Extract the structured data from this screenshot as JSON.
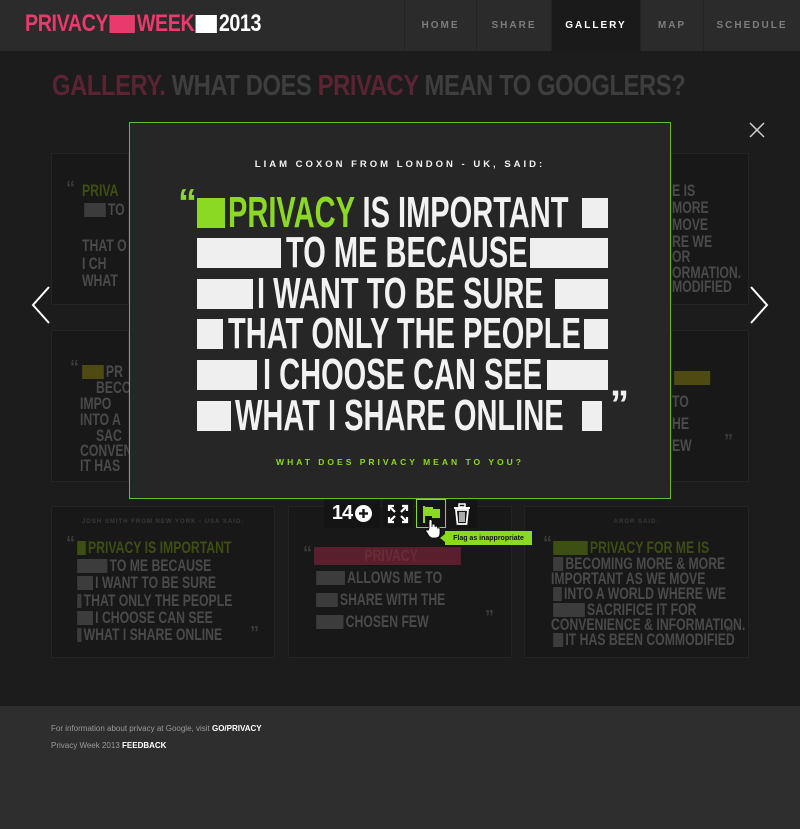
{
  "header": {
    "logo": {
      "part1": "PRIVACY",
      "part2": "WEEK",
      "year": "2013"
    },
    "nav": [
      {
        "label": "HOME",
        "active": false
      },
      {
        "label": "SHARE",
        "active": false
      },
      {
        "label": "GALLERY",
        "active": true
      },
      {
        "label": "MAP",
        "active": false
      },
      {
        "label": "SCHEDULE",
        "active": false
      }
    ]
  },
  "page": {
    "heading_prefix": "GALLERY.",
    "heading_mid": "WHAT DOES",
    "heading_highlight": "PRIVACY",
    "heading_suffix": "MEAN TO GOOGLERS?"
  },
  "background_cards": {
    "card_bl_caption": "JOSH SMITH FROM NEW YORK - USA SAID:",
    "card_bl_lines": [
      "PRIVACY IS IMPORTANT",
      "TO ME BECAUSE",
      "I WANT TO BE SURE",
      "THAT ONLY THE PEOPLE",
      "I CHOOSE CAN SEE",
      "WHAT I SHARE ONLINE"
    ],
    "card_bm_lines": [
      "PRIVACY",
      "ALLOWS ME TO",
      "SHARE WITH THE",
      "CHOSEN FEW"
    ],
    "card_br_caption": "AROR SAID:",
    "card_br_lines": [
      "PRIVACY FOR ME IS",
      "BECOMING MORE & MORE",
      "IMPORTANT AS WE MOVE",
      "INTO A WORLD WHERE WE",
      "SACRIFICE IT FOR",
      "CONVENIENCE & INFORMATION.",
      "IT HAS BEEN COMMODIFIED"
    ],
    "card_tl_lines": [
      "PRIVA",
      "TO",
      "THAT O",
      "I CH",
      "WHAT"
    ],
    "card_ml_lines": [
      "PR",
      "BECOM",
      "IMPO",
      "INTO A",
      "SAC",
      "CONVENIE",
      "IT HAS"
    ],
    "card_tr_lines": [
      "E IS",
      "MORE",
      "MOVE",
      "RE WE",
      "OR",
      "ORMATION.",
      "MODIFIED"
    ],
    "card_mr_lines": [
      "TO",
      "HE",
      "EW"
    ]
  },
  "modal": {
    "caption": "LIAM COXON FROM LONDON - UK, SAID:",
    "quote_open": "“",
    "quote_close": "”",
    "line1_highlight": "PRIVACY",
    "line1_rest": "IS IMPORTANT",
    "line2": "TO ME BECAUSE",
    "line3": "I WANT TO BE SURE",
    "line4": "THAT ONLY THE PEOPLE",
    "line5": "I CHOOSE CAN SEE",
    "line6": "WHAT I SHARE ONLINE",
    "footer": "WHAT DOES PRIVACY MEAN TO YOU?"
  },
  "toolbar": {
    "plus_count": "14",
    "tooltip": "Flag as inappropriate"
  },
  "footer": {
    "info_text": "For information about privacy at Google, visit",
    "info_link": "GO/PRIVACY",
    "event_text": "Privacy Week 2013",
    "feedback_link": "FEEDBACK"
  },
  "colors": {
    "brand_pink": "#ea3a6c",
    "accent_green": "#8bd923"
  }
}
